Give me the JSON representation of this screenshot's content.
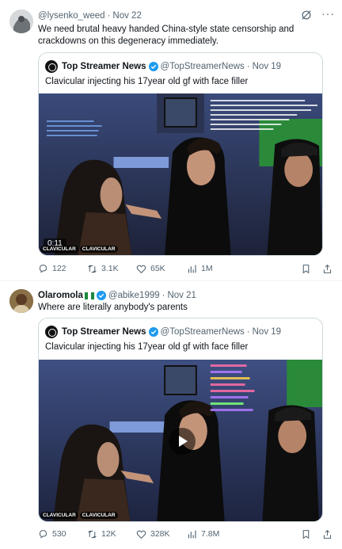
{
  "posts": [
    {
      "author_name": "",
      "handle": "@lysenko_weed",
      "date": "Nov 22",
      "text": "We need brutal heavy handed China-style state censorship and crackdowns on this degeneracy immediately.",
      "quote": {
        "name": "Top Streamer News",
        "handle": "@TopStreamerNews",
        "date": "Nov 19",
        "text": "Clavicular injecting his 17year old gf with face filler",
        "timestamp": "0:11",
        "watermark": [
          "CLAVICULAR",
          "CLAVICULAR"
        ]
      },
      "stats": {
        "replies": "122",
        "reposts": "3.1K",
        "likes": "65K",
        "views": "1M"
      }
    },
    {
      "author_name": "Olaromola",
      "handle": "@abike1999",
      "date": "Nov 21",
      "text": "Where are literally anybody's parents",
      "quote": {
        "name": "Top Streamer News",
        "handle": "@TopStreamerNews",
        "date": "Nov 19",
        "text": "Clavicular injecting his 17year old gf with face filler",
        "watermark": [
          "CLAVICULAR",
          "CLAVICULAR"
        ]
      },
      "stats": {
        "replies": "530",
        "reposts": "12K",
        "likes": "328K",
        "views": "7.8M"
      }
    }
  ],
  "icons": {
    "verified": "verified-badge-icon",
    "grok": "grok-icon",
    "more": "more-icon",
    "reply": "reply-icon",
    "repost": "repost-icon",
    "like": "heart-icon",
    "views": "views-icon",
    "bookmark": "bookmark-icon",
    "share": "share-icon",
    "flag": "nigeria-flag-icon"
  },
  "colors": {
    "verified": "#1d9bf0",
    "text_secondary": "#536471",
    "border": "#cfd9de"
  }
}
